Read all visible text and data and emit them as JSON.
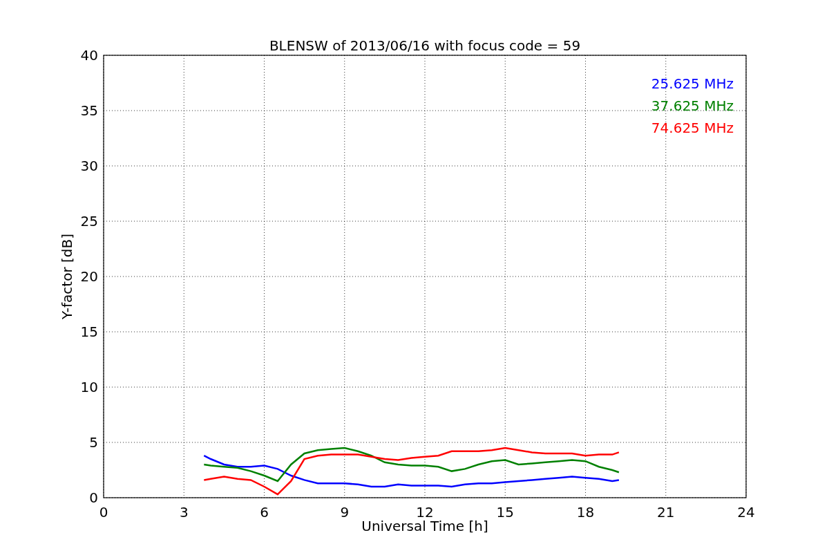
{
  "figure": {
    "chart_data": {
      "type": "line",
      "title": "BLENSW of 2013/06/16 with focus code = 59",
      "xlabel": "Universal Time [h]",
      "ylabel": "Y-factor [dB]",
      "x": [
        3.75,
        4,
        4.5,
        5,
        5.5,
        6,
        6.5,
        7,
        7.5,
        8,
        8.5,
        9,
        9.5,
        10,
        10.5,
        11,
        11.5,
        12,
        12.5,
        13,
        13.5,
        14,
        14.5,
        15,
        15.5,
        16,
        16.5,
        17,
        17.5,
        18,
        18.5,
        19,
        19.25
      ],
      "series": [
        {
          "name": "25.625 MHz",
          "color": "#0000ff",
          "values": [
            3.8,
            3.5,
            3.0,
            2.8,
            2.8,
            2.9,
            2.6,
            2.0,
            1.6,
            1.3,
            1.3,
            1.3,
            1.2,
            1.0,
            1.0,
            1.2,
            1.1,
            1.1,
            1.1,
            1.0,
            1.2,
            1.3,
            1.3,
            1.4,
            1.5,
            1.6,
            1.7,
            1.8,
            1.9,
            1.8,
            1.7,
            1.5,
            1.6
          ]
        },
        {
          "name": "37.625 MHz",
          "color": "#008000",
          "values": [
            3.0,
            2.9,
            2.8,
            2.7,
            2.4,
            2.0,
            1.5,
            3.0,
            4.0,
            4.3,
            4.4,
            4.5,
            4.2,
            3.8,
            3.2,
            3.0,
            2.9,
            2.9,
            2.8,
            2.4,
            2.6,
            3.0,
            3.3,
            3.4,
            3.0,
            3.1,
            3.2,
            3.3,
            3.4,
            3.3,
            2.8,
            2.5,
            2.3
          ]
        },
        {
          "name": "74.625 MHz",
          "color": "#ff0000",
          "values": [
            1.6,
            1.7,
            1.9,
            1.7,
            1.6,
            1.0,
            0.3,
            1.5,
            3.5,
            3.8,
            3.9,
            3.9,
            3.9,
            3.7,
            3.5,
            3.4,
            3.6,
            3.7,
            3.8,
            4.2,
            4.2,
            4.2,
            4.3,
            4.5,
            4.3,
            4.1,
            4.0,
            4.0,
            4.0,
            3.8,
            3.9,
            3.9,
            4.1
          ]
        }
      ],
      "xlim": [
        0,
        24
      ],
      "ylim": [
        0,
        40
      ],
      "xticks": [
        0,
        3,
        6,
        9,
        12,
        15,
        18,
        21,
        24
      ],
      "yticks": [
        0,
        5,
        10,
        15,
        20,
        25,
        30,
        35,
        40
      ],
      "grid": true
    }
  }
}
